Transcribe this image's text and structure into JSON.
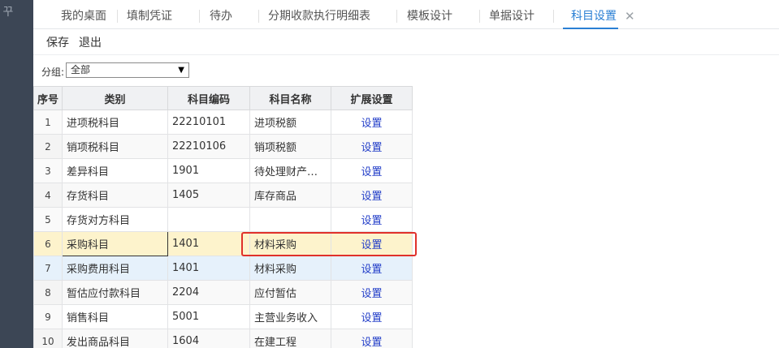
{
  "sidebar": {
    "glyph": "꾸"
  },
  "tabs": [
    {
      "label": "我的桌面"
    },
    {
      "label": "填制凭证"
    },
    {
      "label": "待办"
    },
    {
      "label": "分期收款执行明细表"
    },
    {
      "label": "模板设计"
    },
    {
      "label": "单据设计"
    },
    {
      "label": "科目设置"
    }
  ],
  "active_tab_close": "✕",
  "toolbar": {
    "save_label": "保存",
    "exit_label": "退出"
  },
  "filter": {
    "label": "分组:",
    "value": "全部",
    "caret": "▼"
  },
  "table": {
    "headers": [
      "序号",
      "类别",
      "科目编码",
      "科目名称",
      "扩展设置"
    ],
    "rows": [
      {
        "seq": "1",
        "category": "进项税科目",
        "code": "22210101",
        "name": "进项税额",
        "action": "设置"
      },
      {
        "seq": "2",
        "category": "销项税科目",
        "code": "22210106",
        "name": "销项税额",
        "action": "设置"
      },
      {
        "seq": "3",
        "category": "差异科目",
        "code": "1901",
        "name": "待处理财产…",
        "action": "设置"
      },
      {
        "seq": "4",
        "category": "存货科目",
        "code": "1405",
        "name": "库存商品",
        "action": "设置"
      },
      {
        "seq": "5",
        "category": "存货对方科目",
        "code": "",
        "name": "",
        "action": "设置"
      },
      {
        "seq": "6",
        "category": "采购科目",
        "code": "1401",
        "name": "材料采购",
        "action": "设置"
      },
      {
        "seq": "7",
        "category": "采购费用科目",
        "code": "1401",
        "name": "材料采购",
        "action": "设置"
      },
      {
        "seq": "8",
        "category": "暂估应付款科目",
        "code": "2204",
        "name": "应付暂估",
        "action": "设置"
      },
      {
        "seq": "9",
        "category": "销售科目",
        "code": "5001",
        "name": "主营业务收入",
        "action": "设置"
      },
      {
        "seq": "10",
        "category": "发出商品科目",
        "code": "1604",
        "name": "在建工程",
        "action": "设置"
      }
    ]
  },
  "colors": {
    "sidebar": "#3c4655",
    "accent": "#2a7fd4",
    "link": "#2540c9",
    "selected_row": "#fdf3cc",
    "hover_row": "#e6f1fb",
    "annotation": "#e0312b"
  }
}
